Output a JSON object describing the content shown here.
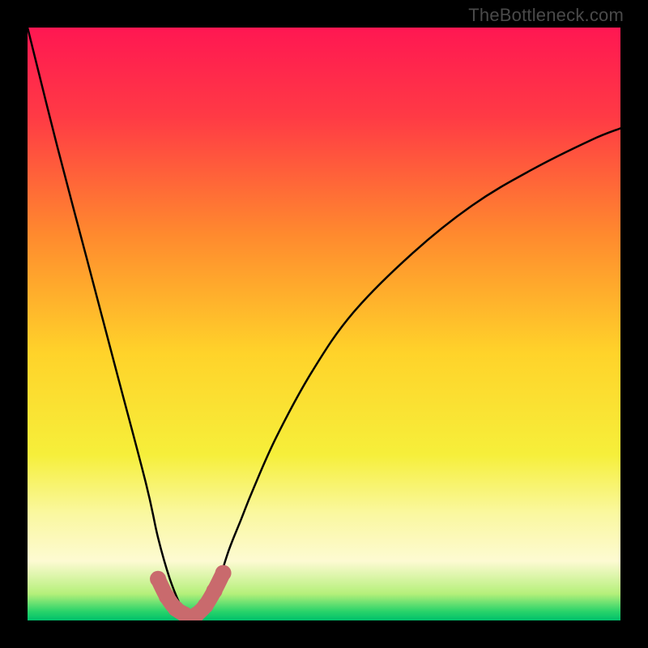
{
  "watermark": "TheBottleneck.com",
  "chart_data": {
    "type": "line",
    "title": "",
    "xlabel": "",
    "ylabel": "",
    "xlim": [
      0,
      100
    ],
    "ylim": [
      0,
      100
    ],
    "series": [
      {
        "name": "curve",
        "x": [
          0,
          5,
          10,
          15,
          20,
          22,
          24,
          26,
          27,
          28,
          30,
          32,
          34,
          36,
          38,
          42,
          48,
          55,
          65,
          75,
          85,
          95,
          100
        ],
        "y": [
          100,
          80,
          61,
          42,
          23,
          14,
          7,
          2,
          0,
          0,
          2,
          6,
          12,
          17,
          22,
          31,
          42,
          52,
          62,
          70,
          76,
          81,
          83
        ]
      }
    ],
    "highlight": {
      "name": "bottom-marker",
      "x": [
        22,
        23.5,
        25,
        26.5,
        27.25,
        28.5,
        30,
        31.5,
        33
      ],
      "y": [
        7,
        4,
        2,
        1,
        0.2,
        1,
        2.5,
        5,
        8
      ],
      "color": "#c96a6d"
    },
    "gradient_stops": [
      {
        "offset": 0.0,
        "color": "#ff1752"
      },
      {
        "offset": 0.15,
        "color": "#ff3a45"
      },
      {
        "offset": 0.35,
        "color": "#ff8a2e"
      },
      {
        "offset": 0.55,
        "color": "#ffd32a"
      },
      {
        "offset": 0.72,
        "color": "#f6ef3a"
      },
      {
        "offset": 0.82,
        "color": "#faf8a0"
      },
      {
        "offset": 0.9,
        "color": "#fdfad2"
      },
      {
        "offset": 0.955,
        "color": "#b5f07a"
      },
      {
        "offset": 0.985,
        "color": "#28d36a"
      },
      {
        "offset": 1.0,
        "color": "#00c06b"
      }
    ]
  }
}
